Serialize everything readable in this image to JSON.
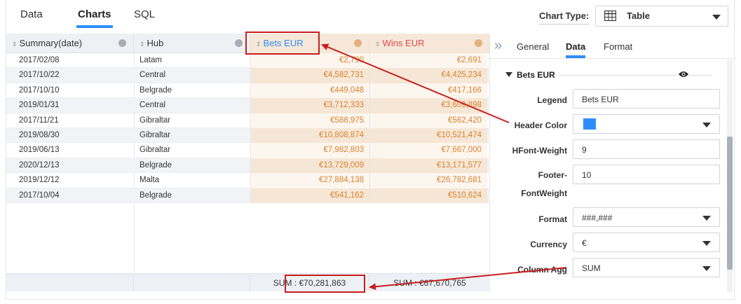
{
  "top_tabs": [
    {
      "label": "Data",
      "active": false
    },
    {
      "label": "Charts",
      "active": true
    },
    {
      "label": "SQL",
      "active": false
    }
  ],
  "chart_type": {
    "label": "Chart Type:",
    "value": "Table",
    "icon": "table-icon"
  },
  "grid": {
    "columns": [
      {
        "label": "Summary(date)"
      },
      {
        "label": "Hub"
      },
      {
        "label": "Bets EUR",
        "color": "#2f8dfa"
      },
      {
        "label": "Wins EUR",
        "color": "#e04a4a"
      }
    ],
    "rows": [
      {
        "date": "2017/02/08",
        "hub": "Latam",
        "bets": "€2,790",
        "wins": "€2,691"
      },
      {
        "date": "2017/10/22",
        "hub": "Central",
        "bets": "€4,582,731",
        "wins": "€4,425,234"
      },
      {
        "date": "2017/10/10",
        "hub": "Belgrade",
        "bets": "€449,048",
        "wins": "€417,166"
      },
      {
        "date": "2019/01/31",
        "hub": "Central",
        "bets": "€3,712,333",
        "wins": "€3,609,898"
      },
      {
        "date": "2017/11/21",
        "hub": "Gibraltar",
        "bets": "€588,975",
        "wins": "€562,420"
      },
      {
        "date": "2019/08/30",
        "hub": "Gibraltar",
        "bets": "€10,808,874",
        "wins": "€10,521,474"
      },
      {
        "date": "2019/06/13",
        "hub": "Gibraltar",
        "bets": "€7,982,803",
        "wins": "€7,667,000"
      },
      {
        "date": "2020/12/13",
        "hub": "Belgrade",
        "bets": "€13,729,009",
        "wins": "€13,171,577"
      },
      {
        "date": "2019/12/12",
        "hub": "Malta",
        "bets": "€27,884,138",
        "wins": "€26,782,681"
      },
      {
        "date": "2017/10/04",
        "hub": "Belgrade",
        "bets": "€541,162",
        "wins": "€510,624"
      }
    ],
    "footer": {
      "bets": "SUM : €70,281,863",
      "wins": "SUM : €67,670,765"
    },
    "header_tint": "#f6e7d8",
    "value_color": "#d9822b"
  },
  "panel": {
    "tabs": [
      {
        "label": "General",
        "active": false
      },
      {
        "label": "Data",
        "active": true
      },
      {
        "label": "Format",
        "active": false
      }
    ],
    "section_title": "Bets EUR",
    "fields": {
      "legend": {
        "label": "Legend",
        "value": "Bets EUR"
      },
      "header_color": {
        "label": "Header Color",
        "value": "#2f8dfa"
      },
      "hfont_weight": {
        "label": "HFont-Weight",
        "value": "9"
      },
      "footer_fontweight": {
        "label_line1": "Footer-",
        "label_line2": "FontWeight",
        "value": "10"
      },
      "format": {
        "label": "Format",
        "value": "###,###"
      },
      "currency": {
        "label": "Currency",
        "value": "€"
      },
      "column_agg": {
        "label": "Column Agg",
        "value": "SUM"
      }
    }
  },
  "annotation_color": "#c81e1e"
}
